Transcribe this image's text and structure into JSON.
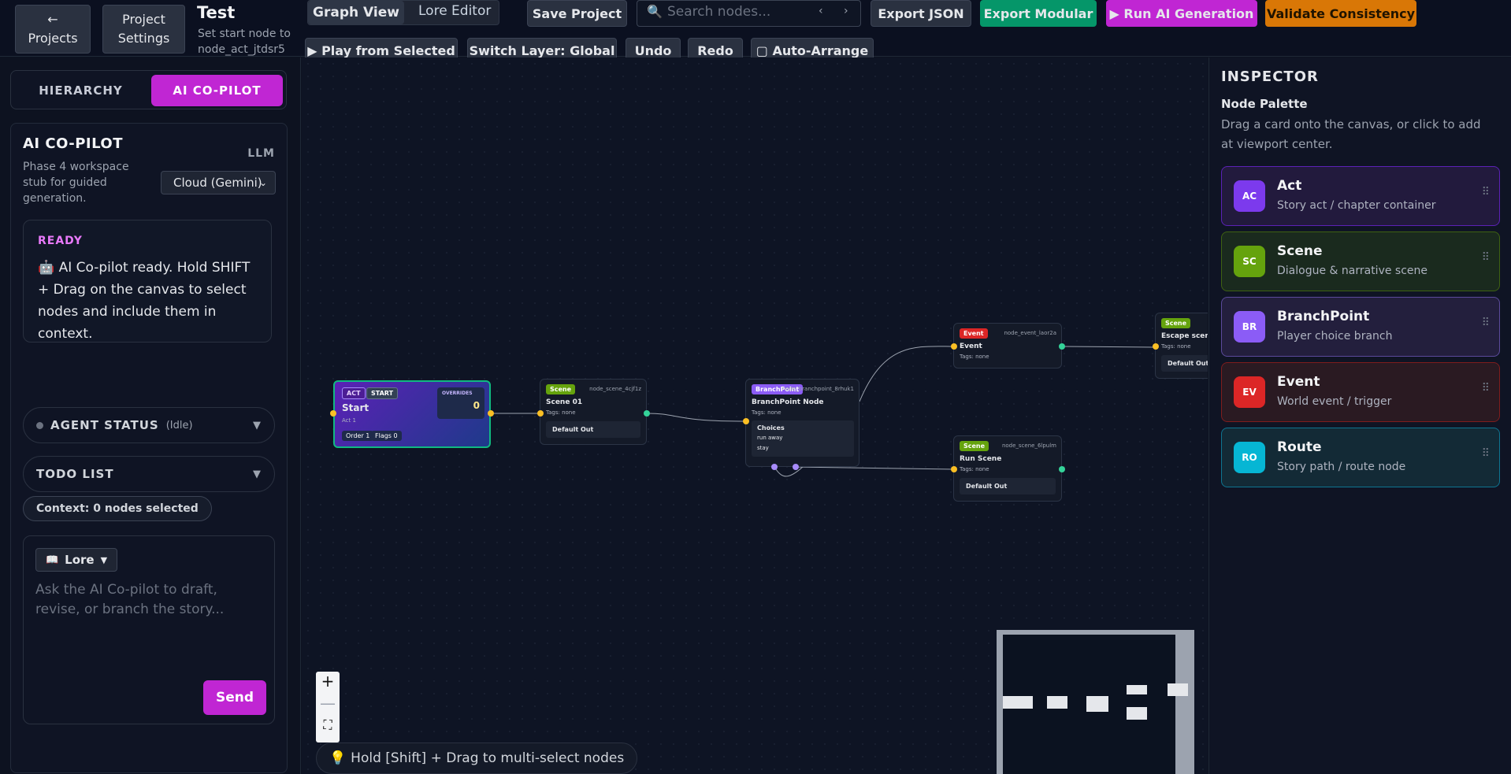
{
  "header": {
    "projects_arrow": "←",
    "projects_label": "Projects",
    "settings_line1": "Project",
    "settings_line2": "Settings",
    "project_title": "Test",
    "start_hint": "Set start node to node_act_jtdsr5",
    "view_tabs": [
      "Graph View",
      "Lore Editor"
    ],
    "save_label": "Save Project",
    "search_placeholder": "Search nodes...",
    "search_prev": "‹",
    "search_next": "›",
    "export_json": "Export JSON",
    "export_modular": "Export Modular",
    "run_ai": "▶ Run AI Generation",
    "validate": "Validate Consistency",
    "play_selected": "▶ Play from Selected",
    "switch_layer": "Switch Layer: Global",
    "undo": "Undo",
    "redo": "Redo",
    "auto_arrange": "▢ Auto-Arrange"
  },
  "sidebar": {
    "tabs": [
      "HIERARCHY",
      "AI CO-PILOT"
    ],
    "active_tab": "AI CO-PILOT",
    "copilot_title": "AI CO-PILOT",
    "copilot_desc": "Phase 4 workspace stub for guided generation.",
    "llm_label": "LLM",
    "llm_value": "Cloud (Gemini)",
    "status_label": "READY",
    "status_text": "🤖 AI Co-pilot ready. Hold SHIFT + Drag on the canvas to select nodes and include them in context.",
    "agent_status_label": "AGENT STATUS",
    "agent_status_state": "(Idle)",
    "todo_label": "TODO LIST",
    "context_text": "Context: 0 nodes selected",
    "lore_label": "Lore",
    "lore_icon": "📖",
    "input_placeholder": "Ask the AI Co-pilot to draft, revise, or branch the story...",
    "send_label": "Send"
  },
  "canvas": {
    "zoom_in": "+",
    "zoom_out": "—",
    "fit": "⛶",
    "hint_icon": "💡",
    "hint_text": "Hold [Shift] + Drag to multi-select nodes",
    "nodes": {
      "start": {
        "type_pill": "ACT",
        "start_pill": "START",
        "title": "Start",
        "subtitle": "Act 1",
        "overrides_label": "OVERRIDES",
        "overrides_value": "0",
        "order": "Order 1",
        "flags": "Flags 0"
      },
      "scene01": {
        "type_pill": "Scene",
        "id": "node_scene_4cjf1z",
        "title": "Scene 01",
        "tags": "Tags: none",
        "output": "Default Out"
      },
      "branch": {
        "type_pill": "BranchPoint",
        "id": "node_branchpoint_8rhuk1",
        "title": "BranchPoint Node",
        "tags": "Tags: none",
        "choices_label": "Choices",
        "choices": [
          "run away",
          "stay"
        ]
      },
      "event": {
        "type_pill": "Event",
        "id": "node_event_laor2a",
        "title": "Event",
        "tags": "Tags: none"
      },
      "run": {
        "type_pill": "Scene",
        "id": "node_scene_6lpulm",
        "title": "Run Scene",
        "tags": "Tags: none",
        "output": "Default Out"
      },
      "escape": {
        "type_pill": "Scene",
        "title": "Escape scene",
        "tags": "Tags: none",
        "output": "Default Out"
      }
    }
  },
  "inspector": {
    "title": "INSPECTOR",
    "palette_title": "Node Palette",
    "palette_desc": "Drag a card onto the canvas, or click to add at viewport center.",
    "cards": [
      {
        "badge": "AC",
        "title": "Act",
        "desc": "Story act / chapter container",
        "color": "#7c3aed"
      },
      {
        "badge": "SC",
        "title": "Scene",
        "desc": "Dialogue & narrative scene",
        "color": "#65a30d"
      },
      {
        "badge": "BR",
        "title": "BranchPoint",
        "desc": "Player choice branch",
        "color": "#8b5cf6"
      },
      {
        "badge": "EV",
        "title": "Event",
        "desc": "World event / trigger",
        "color": "#dc2626"
      },
      {
        "badge": "RO",
        "title": "Route",
        "desc": "Story path / route node",
        "color": "#06b6d4"
      }
    ],
    "grip": "⠿"
  }
}
